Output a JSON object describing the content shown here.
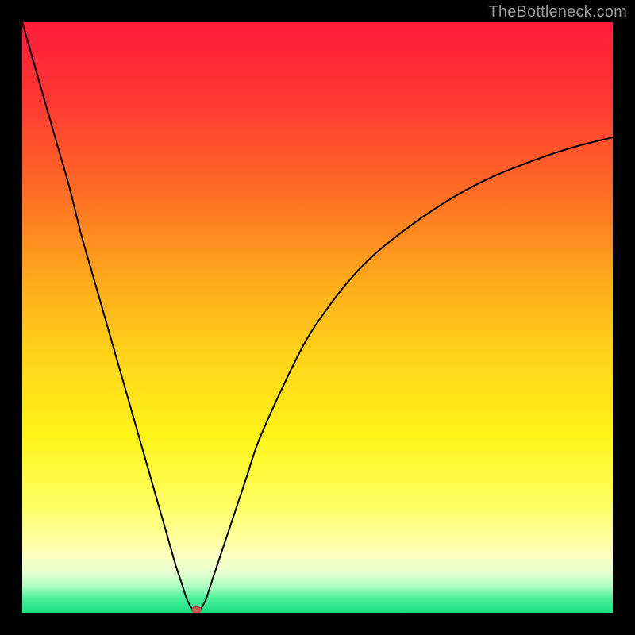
{
  "watermark": "TheBottleneck.com",
  "chart_data": {
    "type": "line",
    "title": "",
    "xlabel": "",
    "ylabel": "",
    "xlim": [
      0,
      100
    ],
    "ylim": [
      0,
      100
    ],
    "grid": false,
    "legend": false,
    "background_gradient": {
      "stops": [
        {
          "offset": 0.0,
          "color": "#ff1b3a"
        },
        {
          "offset": 0.14,
          "color": "#ff3a32"
        },
        {
          "offset": 0.28,
          "color": "#ff6a26"
        },
        {
          "offset": 0.42,
          "color": "#ffa31c"
        },
        {
          "offset": 0.56,
          "color": "#ffd21a"
        },
        {
          "offset": 0.7,
          "color": "#fff419"
        },
        {
          "offset": 0.82,
          "color": "#ffff64"
        },
        {
          "offset": 0.9,
          "color": "#ffffbd"
        },
        {
          "offset": 0.93,
          "color": "#e9ffd0"
        },
        {
          "offset": 0.955,
          "color": "#aeffc0"
        },
        {
          "offset": 0.975,
          "color": "#4cf19a"
        },
        {
          "offset": 1.0,
          "color": "#19dd84"
        }
      ]
    },
    "series": [
      {
        "name": "bottleneck-curve",
        "color": "#000000",
        "stroke_width": 2,
        "x": [
          0,
          2,
          4,
          6,
          8,
          10,
          12,
          14,
          16,
          18,
          20,
          22,
          24,
          26,
          27,
          28,
          29,
          30,
          31,
          32,
          34,
          36,
          38,
          40,
          44,
          48,
          52,
          56,
          60,
          65,
          70,
          75,
          80,
          85,
          90,
          95,
          100
        ],
        "y": [
          100,
          93,
          86,
          79,
          72,
          64,
          57,
          50,
          43,
          36,
          29,
          22,
          15,
          8,
          5,
          2,
          0.5,
          0.5,
          2,
          5,
          11,
          17,
          23,
          29,
          38,
          46,
          52,
          57,
          61,
          65,
          68.5,
          71.5,
          74,
          76,
          77.8,
          79.3,
          80.5
        ]
      }
    ],
    "marker": {
      "name": "min-point",
      "x": 29.5,
      "y": 0.5,
      "rx": 6,
      "ry": 4,
      "color": "#c45a5a"
    }
  }
}
